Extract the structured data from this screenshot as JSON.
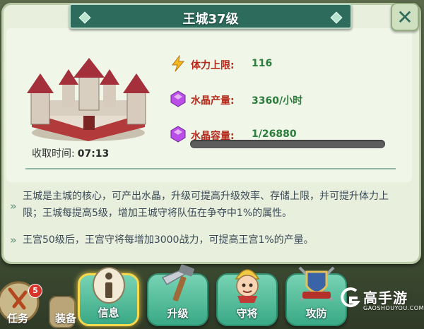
{
  "header": {
    "title": "王城37级"
  },
  "castle": {
    "collect_label": "收取时间:",
    "collect_time": "07:13"
  },
  "stats": [
    {
      "icon": "lightning-icon",
      "label": "体力上限:",
      "value": "116"
    },
    {
      "icon": "crystal-icon",
      "label": "水晶产量:",
      "value": "3360/小时"
    },
    {
      "icon": "crystal-icon",
      "label": "水晶容量:",
      "value": "1/26880"
    }
  ],
  "capacity_fill": 0.0,
  "description": [
    "王城是主城的核心，可产出水晶，升级可提高升级效率、存储上限，并可提升体力上限；王城每提高5级，增加王城守将队伍在争夺中1%的属性。",
    "王宫50级后，王宫守将每增加3000战力，可提高王宫1%的产量。"
  ],
  "buttons": [
    {
      "label": "信息",
      "icon": "info-icon",
      "active": true
    },
    {
      "label": "升级",
      "icon": "hammer-saw-icon",
      "active": false
    },
    {
      "label": "守将",
      "icon": "general-icon",
      "active": false
    },
    {
      "label": "攻防",
      "icon": "shield-swords-icon",
      "active": false
    }
  ],
  "left_stubs": {
    "task_label": "任务",
    "task_badge": "5",
    "equip_label": "装备"
  },
  "watermark": {
    "name": "高手游",
    "url": "GAOSHOUYOU.COM"
  },
  "colors": {
    "panel": "#e8efdd",
    "title_bar": "#2d6b5c",
    "label_red": "#b52a1c",
    "value_green": "#2a7d3a",
    "button_teal": "#3aa985",
    "active_glow": "#f7d84e"
  }
}
